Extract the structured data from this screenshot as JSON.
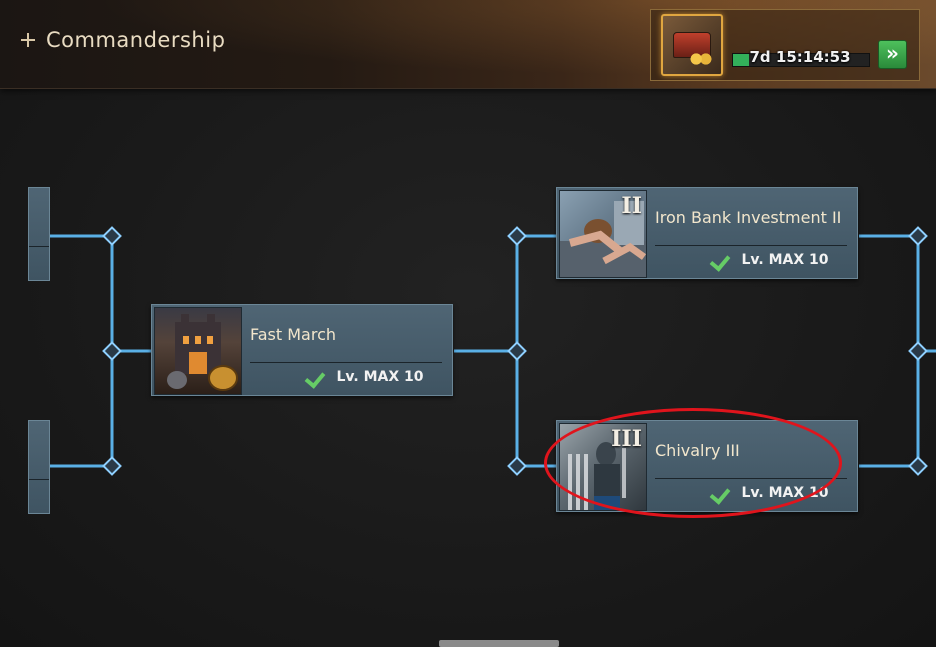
{
  "header": {
    "title": "Commandership",
    "timer": "7d 15:14:53",
    "timer_progress": 0.12,
    "go_button_icon": "double-chevron-right-icon",
    "boost_item_icon": "treasure-chest-icon"
  },
  "nodes": {
    "fast_march": {
      "name": "Fast March",
      "level": "Lv. MAX 10"
    },
    "iron_bank": {
      "name": "Iron Bank Investment II",
      "level": "Lv. MAX 10",
      "roman": "II"
    },
    "chivalry": {
      "name": "Chivalry III",
      "level": "Lv. MAX 10",
      "roman": "III"
    }
  },
  "colors": {
    "connector": "#5ab0e6",
    "node_bg": "#4a5f6d",
    "check": "#66cc66",
    "highlight": "#e0141c"
  }
}
